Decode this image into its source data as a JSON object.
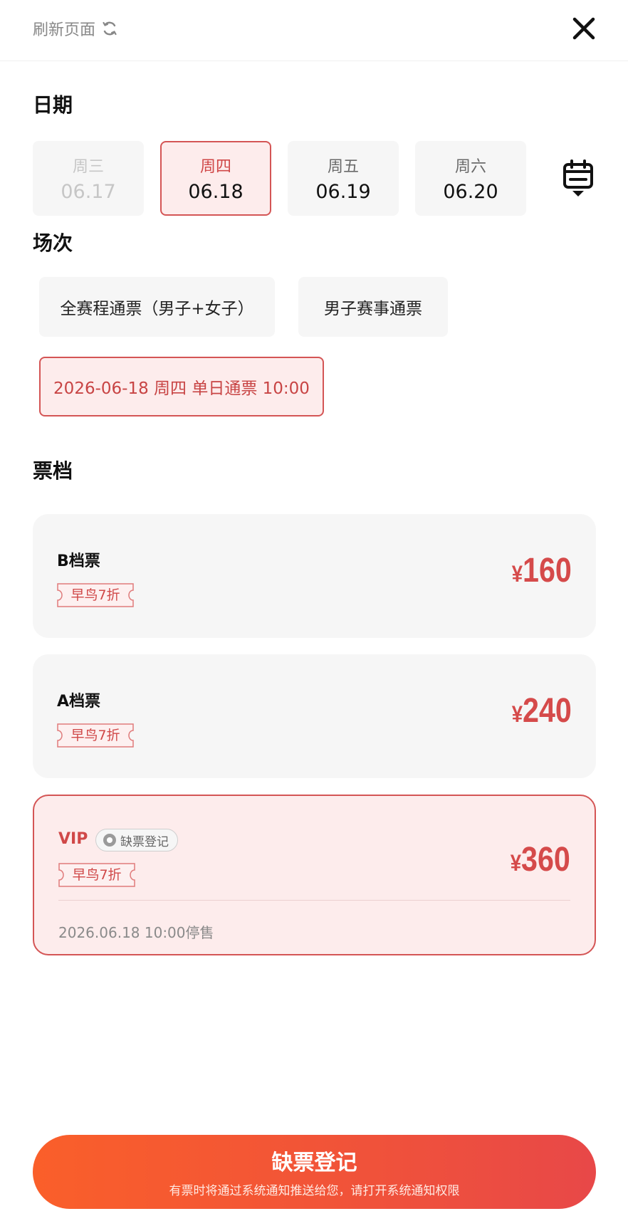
{
  "header": {
    "refresh_label": "刷新页面"
  },
  "sections": {
    "date_title": "日期",
    "session_title": "场次",
    "tier_title": "票档"
  },
  "dates": [
    {
      "weekday": "周三",
      "date": "06.17",
      "state": "disabled"
    },
    {
      "weekday": "周四",
      "date": "06.18",
      "state": "selected"
    },
    {
      "weekday": "周五",
      "date": "06.19",
      "state": "normal"
    },
    {
      "weekday": "周六",
      "date": "06.20",
      "state": "normal"
    }
  ],
  "sessions": [
    {
      "label": "全赛程通票（男子+女子）",
      "state": "normal"
    },
    {
      "label": "男子赛事通票",
      "state": "normal"
    },
    {
      "label": "2026-06-18 周四 单日通票 10:00",
      "state": "selected"
    }
  ],
  "tiers": [
    {
      "name": "B档票",
      "tag": "早鸟7折",
      "currency": "¥",
      "price": "160",
      "state": "normal"
    },
    {
      "name": "A档票",
      "tag": "早鸟7折",
      "currency": "¥",
      "price": "240",
      "state": "normal"
    },
    {
      "name": "VIP",
      "badge": "缺票登记",
      "tag": "早鸟7折",
      "currency": "¥",
      "price": "360",
      "note": "2026.06.18 10:00停售",
      "state": "selected"
    }
  ],
  "cta": {
    "label": "缺票登记",
    "sub": "有票时将通过系统通知推送给您，请打开系统通知权限"
  },
  "colors": {
    "accent": "#d54a4a",
    "selected_bg": "#fdecec",
    "card_bg": "#f6f6f6",
    "cta_start": "#fa5f2a",
    "cta_end": "#e84848"
  }
}
